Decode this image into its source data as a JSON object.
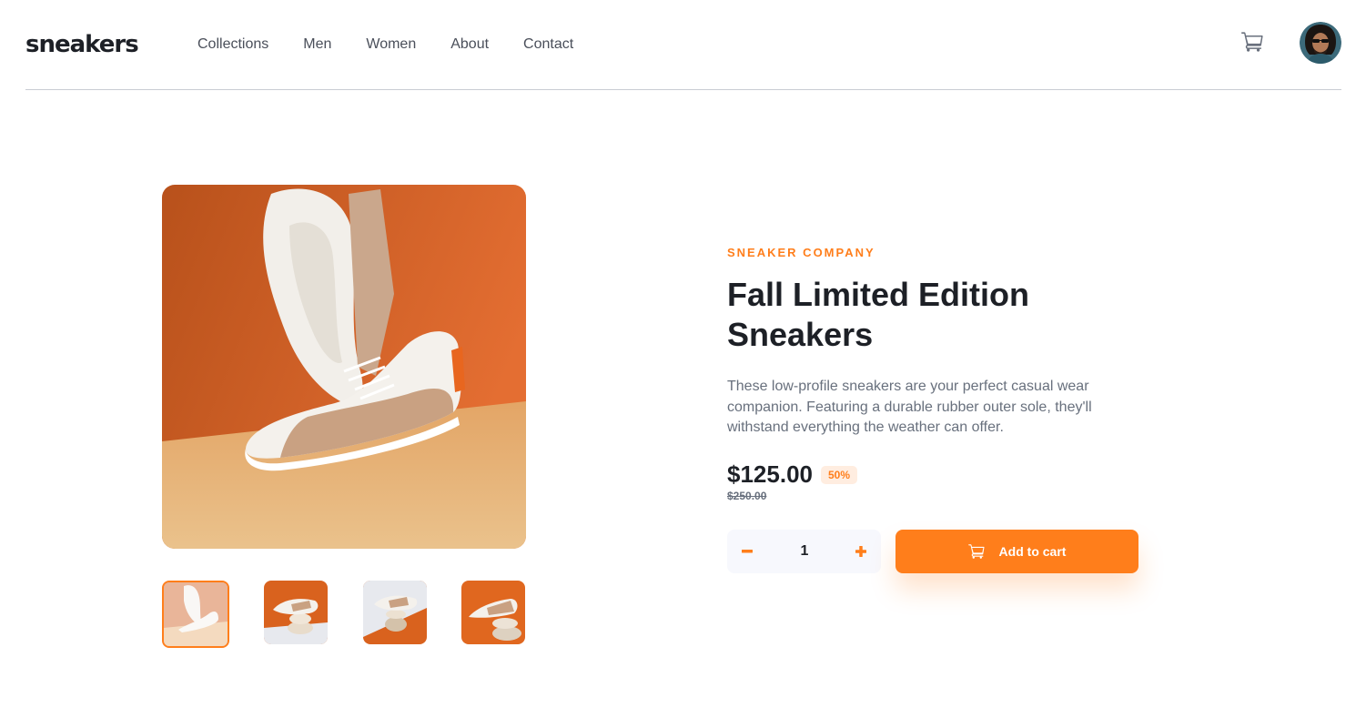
{
  "brand": {
    "logo": "sneakers"
  },
  "nav": {
    "items": [
      "Collections",
      "Men",
      "Women",
      "About",
      "Contact"
    ]
  },
  "header": {
    "cart_icon": "cart-icon",
    "avatar": "user-avatar"
  },
  "product": {
    "company": "SNEAKER COMPANY",
    "title": "Fall Limited Edition Sneakers",
    "description": "These low-profile sneakers are your perfect casual wear companion. Featuring a durable rubber outer sole, they'll withstand everything the weather can offer.",
    "price": "$125.00",
    "discount": "50%",
    "old_price": "$250.00",
    "quantity": "1",
    "add_to_cart_label": "Add to cart"
  },
  "gallery": {
    "thumbnail_count": 4,
    "active_thumbnail": 1
  },
  "colors": {
    "accent": "#ff7e1b",
    "accent_pale": "#ffede0",
    "text_dark": "#1d2026",
    "text_muted": "#68707d",
    "qty_bg": "#f7f8fd"
  }
}
